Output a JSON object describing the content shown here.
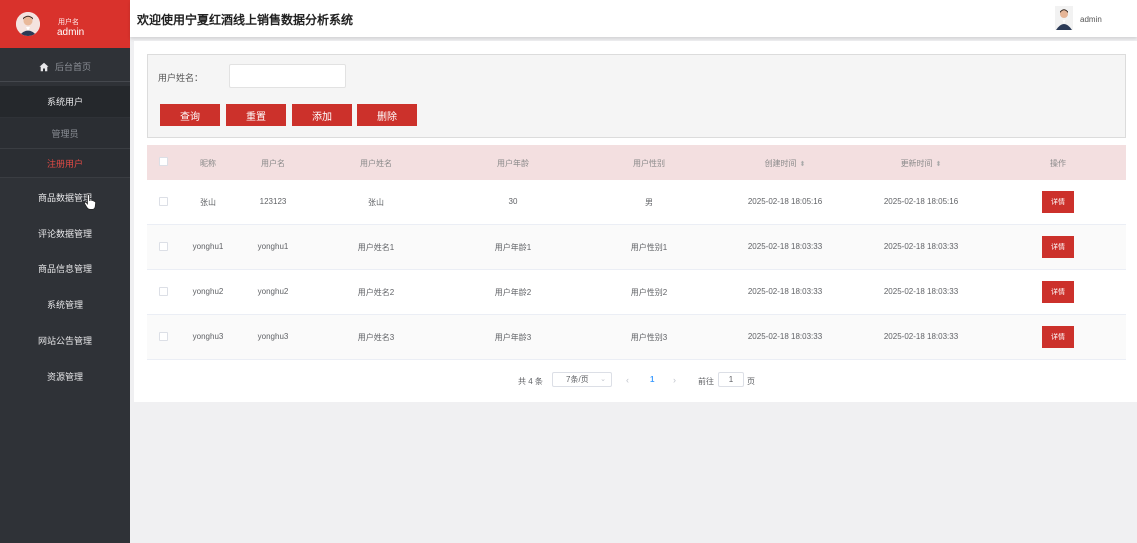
{
  "app": {
    "title": "欢迎使用宁夏红酒线上销售数据分析系统",
    "top_user": "admin"
  },
  "sidebar": {
    "user_label": "用户名",
    "user_name": "admin",
    "home": "后台首页",
    "group": "系统用户",
    "sub_items": [
      "管理员",
      "注册用户"
    ],
    "items": [
      "商品数据管理",
      "评论数据管理",
      "商品信息管理",
      "系统管理",
      "网站公告管理",
      "资源管理"
    ]
  },
  "search": {
    "label": "用户姓名：",
    "value": "",
    "buttons": {
      "query": "查询",
      "reset": "重置",
      "add": "添加",
      "delete": "删除"
    }
  },
  "table": {
    "columns": [
      "昵称",
      "用户名",
      "用户姓名",
      "用户年龄",
      "用户性别",
      "创建时间",
      "更新时间",
      "操作"
    ],
    "rows": [
      {
        "nickname": "张山",
        "username": "123123",
        "realname": "张山",
        "age": "30",
        "gender": "男",
        "created": "2025-02-18 18:05:16",
        "updated": "2025-02-18 18:05:16",
        "action": "详情"
      },
      {
        "nickname": "yonghu1",
        "username": "yonghu1",
        "realname": "用户姓名1",
        "age": "用户年龄1",
        "gender": "用户性别1",
        "created": "2025-02-18 18:03:33",
        "updated": "2025-02-18 18:03:33",
        "action": "详情"
      },
      {
        "nickname": "yonghu2",
        "username": "yonghu2",
        "realname": "用户姓名2",
        "age": "用户年龄2",
        "gender": "用户性别2",
        "created": "2025-02-18 18:03:33",
        "updated": "2025-02-18 18:03:33",
        "action": "详情"
      },
      {
        "nickname": "yonghu3",
        "username": "yonghu3",
        "realname": "用户姓名3",
        "age": "用户年龄3",
        "gender": "用户性别3",
        "created": "2025-02-18 18:03:33",
        "updated": "2025-02-18 18:03:33",
        "action": "详情"
      }
    ]
  },
  "pagination": {
    "total": "共 4 条",
    "page_size": "7条/页",
    "current_page": "1",
    "goto_label": "前往",
    "goto_value": "1",
    "page_suffix": "页"
  },
  "colors": {
    "brand_red": "#cc312b",
    "sidebar_bg": "#2f3237",
    "header_row_bg": "#f3dfe0",
    "active_link": "#409eff"
  }
}
